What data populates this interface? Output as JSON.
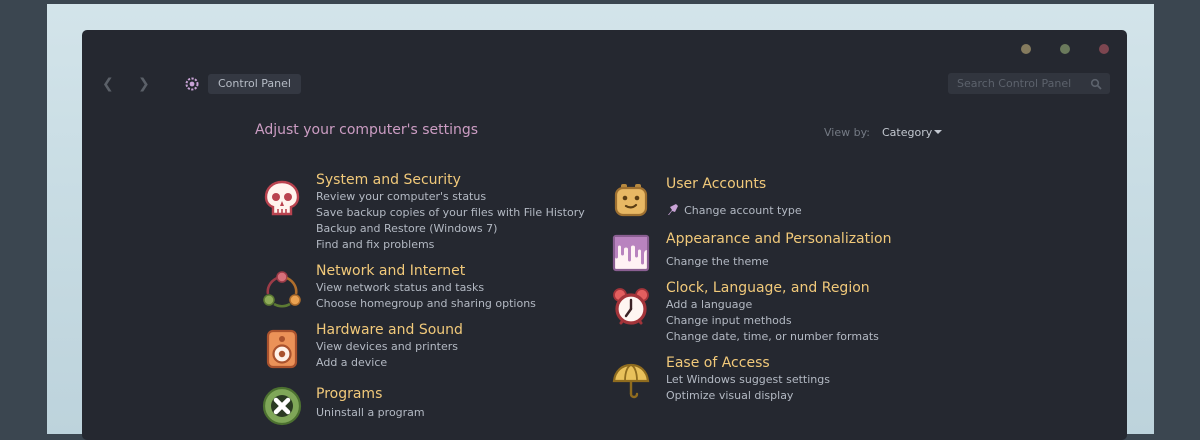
{
  "window": {
    "breadcrumb": "Control Panel",
    "search_placeholder": "Search Control Panel"
  },
  "header": {
    "title": "Adjust your computer's settings",
    "view_by_label": "View by:",
    "view_by_value": "Category"
  },
  "categories_left": [
    {
      "title": "System and Security",
      "links": [
        "Review your computer's status",
        "Save backup copies of your files with File History",
        "Backup and Restore (Windows 7)",
        "Find and fix problems"
      ]
    },
    {
      "title": "Network and Internet",
      "links": [
        "View network status and tasks",
        "Choose homegroup and sharing options"
      ]
    },
    {
      "title": "Hardware and Sound",
      "links": [
        "View devices and printers",
        "Add a device"
      ]
    },
    {
      "title": "Programs",
      "links": [
        "Uninstall a program"
      ]
    }
  ],
  "categories_right": [
    {
      "title": "User Accounts",
      "links": [
        "Change account type"
      ]
    },
    {
      "title": "Appearance and Personalization",
      "links": [
        "Change the theme"
      ]
    },
    {
      "title": "Clock, Language, and Region",
      "links": [
        "Add a language",
        "Change input methods",
        "Change date, time, or number formats"
      ]
    },
    {
      "title": "Ease of Access",
      "links": [
        "Let Windows suggest settings",
        "Optimize visual display"
      ]
    }
  ],
  "icons": {
    "system": "skull-icon",
    "network": "network-icon",
    "hardware": "speaker-icon",
    "programs": "programs-icon",
    "users": "user-face-icon",
    "appearance": "paint-drip-icon",
    "clock": "alarm-clock-icon",
    "access": "umbrella-icon",
    "shield": "admin-shield-icon"
  },
  "colors": {
    "title": "#f1c97a",
    "heading": "#cc9dc3",
    "link": "#b3b9c3",
    "window_bg": "#252830"
  }
}
